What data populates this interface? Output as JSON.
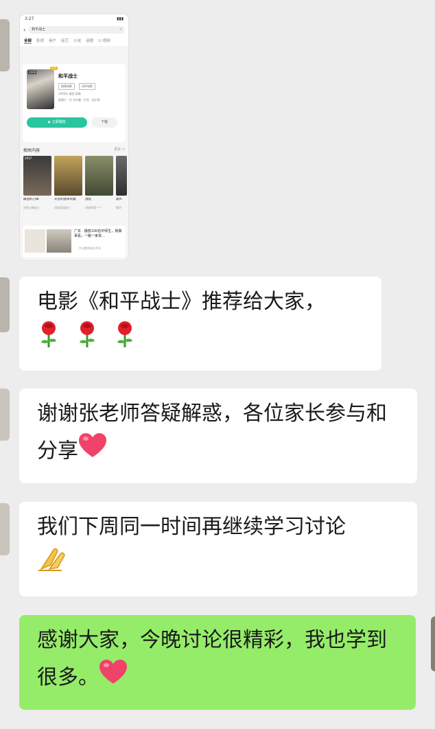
{
  "shared_screenshot": {
    "status_time": "3:27",
    "search_query": "和平战士",
    "tabs": [
      "全部",
      "影视",
      "用户",
      "综艺",
      "小说",
      "话题",
      "☑ 视频"
    ],
    "card": {
      "year_badge": "2006",
      "badge": "会员",
      "title": "和平战士",
      "tags": [
        "剧情电影",
        "动作电影"
      ],
      "meta_line1": "2006年 美国 剧情",
      "meta_line2": "剧情片 · 丹 米尔曼 · 尼克 · 诺尔蒂 ·",
      "play_label": "▶ 立即播放",
      "download_label": "下载"
    },
    "related_label": "相关内容",
    "related_more": "更多 >",
    "thumbs": [
      {
        "year": "2017",
        "title": "最后的刀锋",
        "sub": "讲述刀锋战士"
      },
      {
        "year": "",
        "title": "天堂的战争英雄",
        "sub": "讲述英雄战士"
      },
      {
        "year": "",
        "title": "战役",
        "sub": "讲述的是一个"
      },
      {
        "year": "",
        "title": "歌声",
        "sub": "歌声"
      }
    ],
    "article_text": "广东 · 播放100名中师生，我做事看，一搬一家讲…",
    "article_source": "中山教师成长平台"
  },
  "messages": [
    {
      "side": "left",
      "text": "电影《和平战士》推荐给大家，",
      "emoji": [
        "rose-icon",
        "rose-icon",
        "rose-icon"
      ]
    },
    {
      "side": "left",
      "text": "谢谢张老师答疑解惑，各位家长参与和分享",
      "emoji": [
        "heart-icon"
      ]
    },
    {
      "side": "left",
      "text": "我们下周同一时间再继续学习讨论",
      "emoji": [
        "pray-icon"
      ]
    },
    {
      "side": "right",
      "text": "感谢大家，今晚讨论很精彩，我也学到很多。",
      "emoji": [
        "heart-icon"
      ]
    }
  ],
  "colors": {
    "background": "#ededed",
    "incoming_bubble": "#ffffff",
    "outgoing_bubble": "#95ec69",
    "accent": "#28c5a0"
  }
}
